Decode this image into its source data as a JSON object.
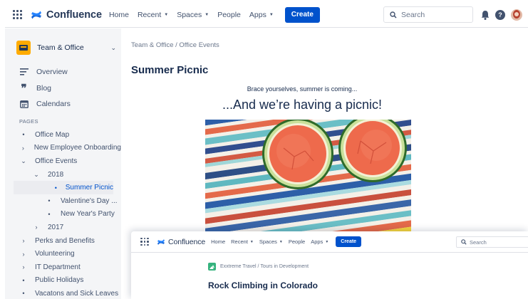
{
  "back_window": {
    "nav": {
      "product_name": "Confluence",
      "links": [
        {
          "label": "Home",
          "dropdown": false
        },
        {
          "label": "Recent",
          "dropdown": true
        },
        {
          "label": "Spaces",
          "dropdown": true
        },
        {
          "label": "People",
          "dropdown": false
        },
        {
          "label": "Apps",
          "dropdown": true
        }
      ],
      "create_label": "Create",
      "search_placeholder": "Search",
      "help_glyph": "?",
      "icons": [
        "app-switcher-icon",
        "confluence-logo-icon",
        "search-icon",
        "bell-icon",
        "help-icon",
        "avatar"
      ]
    },
    "sidebar": {
      "space_name": "Team & Office",
      "nav_items": [
        {
          "label": "Overview",
          "icon": "overview-icon"
        },
        {
          "label": "Blog",
          "icon": "quote-icon"
        },
        {
          "label": "Calendars",
          "icon": "calendar-icon"
        }
      ],
      "pages_label": "PAGES",
      "tree": [
        {
          "label": "Office Map",
          "level": 0,
          "marker": "bullet"
        },
        {
          "label": "New Employee Onboarding",
          "level": 0,
          "marker": "collapsed"
        },
        {
          "label": "Office Events",
          "level": 0,
          "marker": "expanded"
        },
        {
          "label": "2018",
          "level": 1,
          "marker": "expanded"
        },
        {
          "label": "Summer Picnic",
          "level": 2,
          "marker": "bullet",
          "selected": true
        },
        {
          "label": "Valentine's Day ...",
          "level": 2,
          "marker": "bullet"
        },
        {
          "label": "New Year's Party",
          "level": 2,
          "marker": "bullet"
        },
        {
          "label": "2017",
          "level": 1,
          "marker": "collapsed"
        },
        {
          "label": "Perks and Benefits",
          "level": 0,
          "marker": "collapsed"
        },
        {
          "label": "Volunteering",
          "level": 0,
          "marker": "collapsed"
        },
        {
          "label": "IT Department",
          "level": 0,
          "marker": "collapsed"
        },
        {
          "label": "Public Holidays",
          "level": 0,
          "marker": "bullet"
        },
        {
          "label": "Vacatons and Sick Leaves",
          "level": 0,
          "marker": "bullet"
        }
      ]
    },
    "main": {
      "breadcrumb": [
        "Team & Office",
        "Office Events"
      ],
      "title": "Summer Picnic",
      "subline": "Brace yourselves, summer is coming...",
      "headline": "...And we’re having a picnic!",
      "hero_image": "watermelon-halves-on-striped-blanket"
    }
  },
  "front_window": {
    "nav": {
      "product_name": "Confluence",
      "links": [
        {
          "label": "Home",
          "dropdown": false
        },
        {
          "label": "Recent",
          "dropdown": true
        },
        {
          "label": "Spaces",
          "dropdown": true
        },
        {
          "label": "People",
          "dropdown": false
        },
        {
          "label": "Apps",
          "dropdown": true
        }
      ],
      "create_label": "Create",
      "search_placeholder": "Search"
    },
    "breadcrumb": [
      "Exxtreme Travel",
      "Tours in Development"
    ],
    "title": "Rock Climbing in Colorado"
  },
  "colors": {
    "primary": "#0052cc",
    "text": "#172b4d",
    "subtle_text": "#6b778c",
    "sidebar_bg": "#f4f5f7",
    "selected_bg": "#ebecf0",
    "space_icon": "#ffab00",
    "travel_space_icon": "#36b37e"
  }
}
